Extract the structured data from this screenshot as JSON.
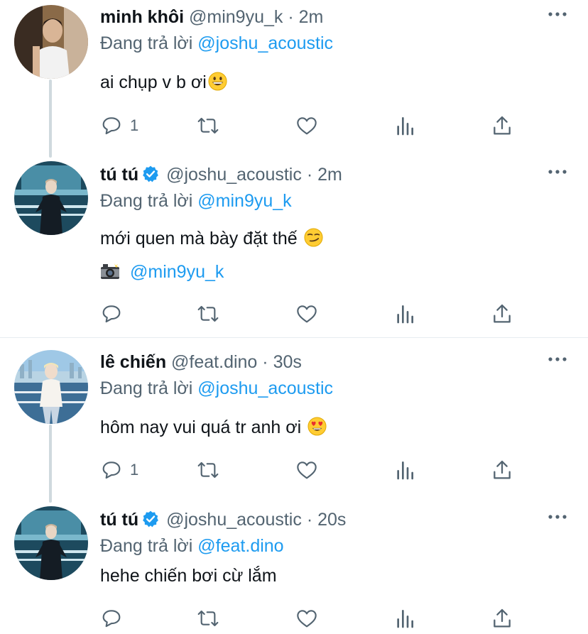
{
  "tweets": [
    {
      "name": "minh khôi",
      "handle": "@min9yu_k",
      "sep": "·",
      "time": "2m",
      "replying_prefix": "Đang trả lời",
      "replying_to": "@joshu_acoustic",
      "text": "ai chụp v b ơi",
      "emoji": "grinning-face",
      "reply_count": "1"
    },
    {
      "name": "tú tú",
      "handle": "@joshu_acoustic",
      "sep": "·",
      "time": "2m",
      "verified": true,
      "replying_prefix": "Đang trả lời",
      "replying_to": "@min9yu_k",
      "text": "mới quen mà bày đặt thế",
      "emoji": "smirking-face",
      "credit_icon": "camera-with-flash-icon",
      "credit_mention": "@min9yu_k",
      "reply_count": ""
    },
    {
      "name": "lê chiến",
      "handle": "@feat.dino",
      "sep": "·",
      "time": "30s",
      "replying_prefix": "Đang trả lời",
      "replying_to": "@joshu_acoustic",
      "text": "hôm nay vui quá tr anh ơi",
      "emoji": "heart-eyes-face",
      "reply_count": "1"
    },
    {
      "name": "tú tú",
      "handle": "@joshu_acoustic",
      "sep": "·",
      "time": "20s",
      "verified": true,
      "replying_prefix": "Đang trả lời",
      "replying_to": "@feat.dino",
      "text": "hehe chiến bơi cừ lắm",
      "reply_count": ""
    }
  ],
  "colors": {
    "accent": "#1d9bf0",
    "secondary_text": "#536471",
    "primary_text": "#0f1419",
    "thread_line": "#cfd9de"
  }
}
